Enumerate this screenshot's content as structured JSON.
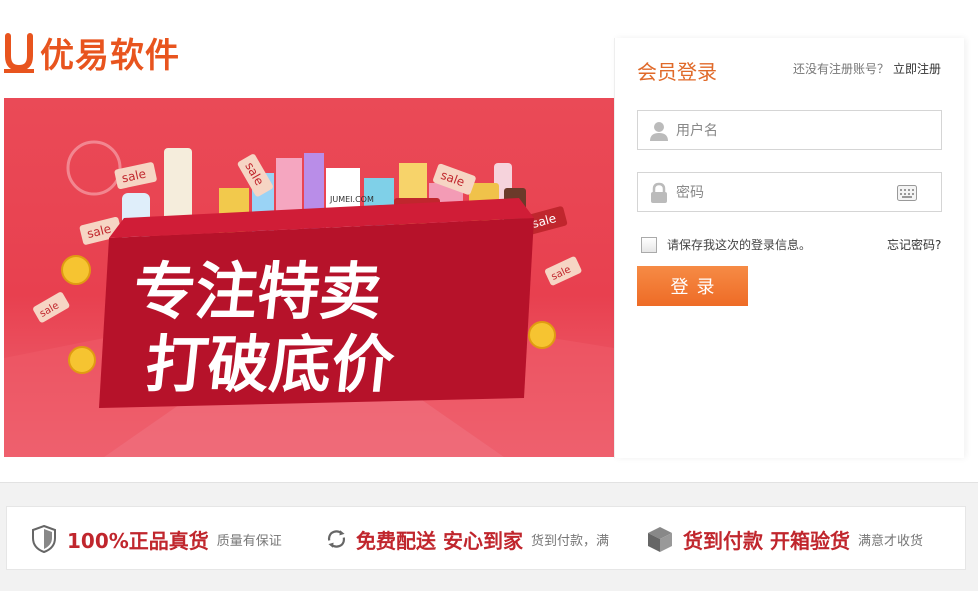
{
  "logo": {
    "brand": "优易软件",
    "icon": "u-logo-icon",
    "color": "#e8541e"
  },
  "banner": {
    "headline_line1": "专注特卖",
    "headline_line2": "打破底价",
    "tags": [
      "sale",
      "sale",
      "sale",
      "sale",
      "sale",
      "sale",
      "sale",
      "sale"
    ],
    "store_sign": "JUMEI.COM"
  },
  "login": {
    "title": "会员登录",
    "no_account_hint": "还没有注册账号？",
    "register_link": "立即注册",
    "username_placeholder": "用户名",
    "password_placeholder": "密码",
    "remember_label": "请保存我这次的登录信息。",
    "forgot_link": "忘记密码?",
    "submit_label": "登录",
    "accent": "#e06a2a",
    "button_color": "#ee6b26"
  },
  "features": [
    {
      "icon": "shield-icon",
      "main": "100%正品真货",
      "sub": "质量有保证"
    },
    {
      "icon": "refresh-icon",
      "main": "免费配送 安心到家",
      "sub": "货到付款，满"
    },
    {
      "icon": "box-icon",
      "main": "货到付款 开箱验货",
      "sub": "满意才收货"
    }
  ]
}
